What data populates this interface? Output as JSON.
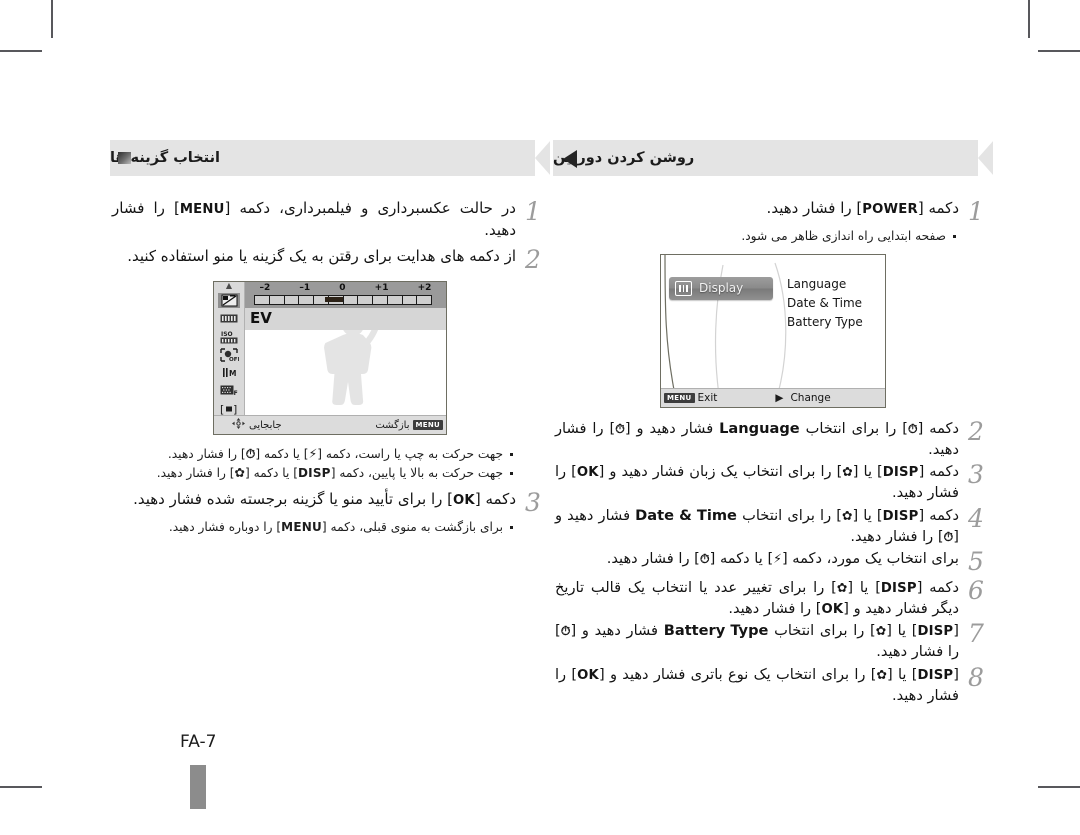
{
  "page": {
    "folio": "FA-7"
  },
  "left_column": {
    "banner": {
      "title": "انتخاب گزینه ها",
      "icon": "filled-square-icon"
    },
    "steps": [
      {
        "num": "1",
        "text": "در حالت عکسبرداری و فیلمبرداری، دکمه [MENU] را فشار دهید.",
        "text_pre": "در حالت عکسبرداری و فیلمبرداری، دکمه [",
        "key": "MENU",
        "text_post": "] را فشار دهید."
      },
      {
        "num": "2",
        "text": "از دکمه های هدایت برای رقتن به یک گزینه یا منو استفاده کنید."
      },
      {
        "num": "3",
        "text_pre": "دکمه [",
        "key": "OK",
        "text_post": "] را برای تأیید منو یا گزینه برجسته شده فشار دهید."
      }
    ],
    "bullets_after_screen": [
      {
        "pre": "جهت حرکت به چپ یا راست، دکمه [",
        "key1": "F",
        "mid": "] یا دکمه [",
        "key2": "t",
        "post": "] را فشار دهید."
      },
      {
        "pre": "جهت حرکت به بالا یا پایین، دکمه [",
        "key1": "DISP",
        "mid": "] یا دکمه [",
        "key2": "M",
        "post": "] را فشار دهید."
      }
    ],
    "bullet_after_step3": {
      "pre": "برای بازگشت به منوی قبلی، دکمه [",
      "key": "MENU",
      "post": "] را دوباره فشار دهید."
    },
    "ev_screen": {
      "scale_labels": [
        "–2",
        "–1",
        "0",
        "+1",
        "+2"
      ],
      "mode_label": "EV",
      "sidebar_icons": [
        "ev-compensation-icon",
        "white-balance-icon",
        "iso-icon",
        "face-detection-off-icon",
        "image-size-icon",
        "image-quality-icon",
        "focus-area-icon"
      ],
      "bottom_left_chip": "MENU",
      "bottom_left_label": "بازگشت",
      "bottom_right_icon": "dpad-icon",
      "bottom_right_label": "جابجایی"
    }
  },
  "right_column": {
    "banner": {
      "title": "روشن کردن دوربین",
      "icon": "triangle-left-icon"
    },
    "steps": [
      {
        "num": "1",
        "text_pre": "دکمه [",
        "key": "POWER",
        "text_post": "] را فشار دهید."
      },
      {
        "num": "2",
        "text_pre": "دکمه [",
        "key1": "t",
        "mid1": "] را برای انتخاب ",
        "en1": "Language",
        "mid2": " فشار دهید و [",
        "key2": "t",
        "post": "] را فشار دهید."
      },
      {
        "num": "3",
        "text_pre": "دکمه [",
        "key1": "DISP",
        "mid1": "] یا [",
        "key2": "M",
        "mid2": "] را برای انتخاب یک زبان فشار دهید و [",
        "key3": "OK",
        "post": "] را فشار دهید."
      },
      {
        "num": "4",
        "text_pre": "دکمه [",
        "key1": "DISP",
        "mid1": "] یا [",
        "key2": "M",
        "mid2": "] را برای انتخاب ",
        "en1": "Date & Time",
        "mid3": " فشار دهید و [",
        "key3": "t",
        "post": "] را فشار دهید."
      },
      {
        "num": "5",
        "text_pre": "برای انتخاب یک مورد، دکمه [",
        "key1": "F",
        "mid1": "] یا دکمه [",
        "key2": "t",
        "post": "] را فشار دهید."
      },
      {
        "num": "6",
        "text_pre": "دکمه [",
        "key1": "DISP",
        "mid1": "] یا [",
        "key2": "M",
        "mid2": "] را برای تغییر عدد یا انتخاب یک قالب تاریخ دیگر فشار دهید و [",
        "key3": "OK",
        "post": "] را فشار دهید."
      },
      {
        "num": "7",
        "text_pre": "[",
        "key1": "DISP",
        "mid1": "] یا [",
        "key2": "M",
        "mid2": "] را برای انتخاب ",
        "en1": "Battery Type",
        "mid3": " فشار دهید و [",
        "key3": "t",
        "post": "] را فشار دهید."
      },
      {
        "num": "8",
        "text_pre": "[",
        "key1": "DISP",
        "mid1": "] یا [",
        "key2": "M",
        "mid2": "] را برای انتخاب یک نوع باتری فشار دهید و [",
        "key3": "OK",
        "post": "] را فشار دهید."
      }
    ],
    "bullet_step1": "صفحه ابتدایی راه اندازی ظاهر می شود.",
    "display_screen": {
      "tab_label": "Display",
      "tab_icon": "display-icon",
      "menu_items": [
        "Language",
        "Date & Time",
        "Battery Type"
      ],
      "bottom_left_chip": "MENU",
      "bottom_left_label": "Exit",
      "bottom_right_icon": "triangle-right-icon",
      "bottom_right_label": "Change"
    }
  },
  "colors": {
    "banner_bg": "#e4e4e4",
    "step_num": "#9c9c9c",
    "text": "#141414",
    "screen_border": "#6e6e62",
    "folio_bar": "#8c8c8c"
  }
}
